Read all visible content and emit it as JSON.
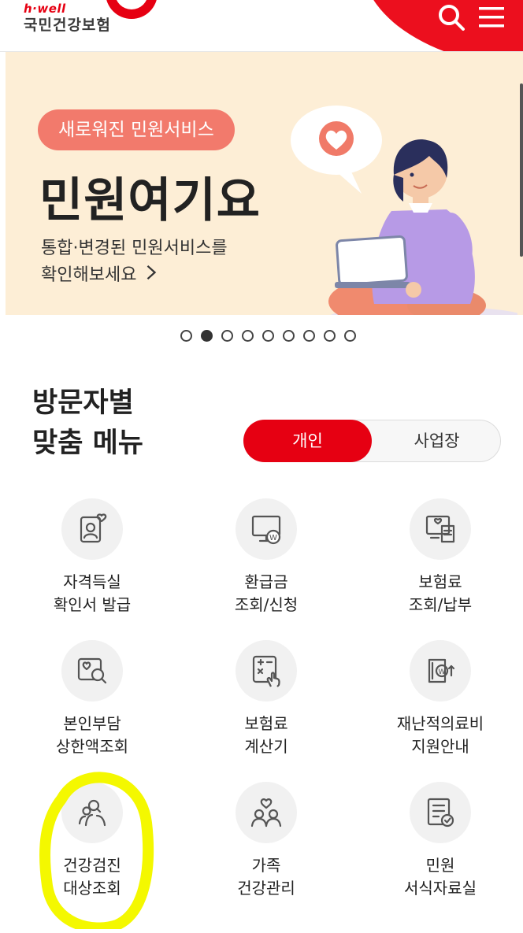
{
  "header": {
    "logo_sub": "h·well",
    "logo_main": "국민건강보험",
    "search_icon": "search-icon",
    "menu_icon": "hamburger-menu-icon",
    "accent": "#ec0f1e"
  },
  "banner": {
    "badge": "새로워진 민원서비스",
    "title": "민원여기요",
    "desc_line1": "통합·변경된 민원서비스를",
    "desc_line2": "확인해보세요",
    "background": "#fdeed6",
    "badge_color": "#f27a6c"
  },
  "carousel": {
    "total": 9,
    "current": 2
  },
  "visitor_menu": {
    "title_line1": "방문자별",
    "title_line2": "맞춤 메뉴",
    "tabs": [
      {
        "label": "개인",
        "selected": true
      },
      {
        "label": "사업장",
        "selected": false
      }
    ],
    "items": [
      {
        "line1": "자격득실",
        "line2": "확인서 발급",
        "icon": "id-card-heart-icon"
      },
      {
        "line1": "환급금",
        "line2": "조회/신청",
        "icon": "monitor-won-icon"
      },
      {
        "line1": "보험료",
        "line2": "조회/납부",
        "icon": "bill-receipt-icon"
      },
      {
        "line1": "본인부담",
        "line2": "상한액조회",
        "icon": "heart-search-icon"
      },
      {
        "line1": "보험료",
        "line2": "계산기",
        "icon": "calculator-hand-icon"
      },
      {
        "line1": "재난적의료비",
        "line2": "지원안내",
        "icon": "wallet-won-icon"
      },
      {
        "line1": "건강검진",
        "line2": "대상조회",
        "icon": "person-group-search-icon"
      },
      {
        "line1": "가족",
        "line2": "건강관리",
        "icon": "family-heart-icon"
      },
      {
        "line1": "민원",
        "line2": "서식자료실",
        "icon": "document-check-icon"
      }
    ]
  }
}
